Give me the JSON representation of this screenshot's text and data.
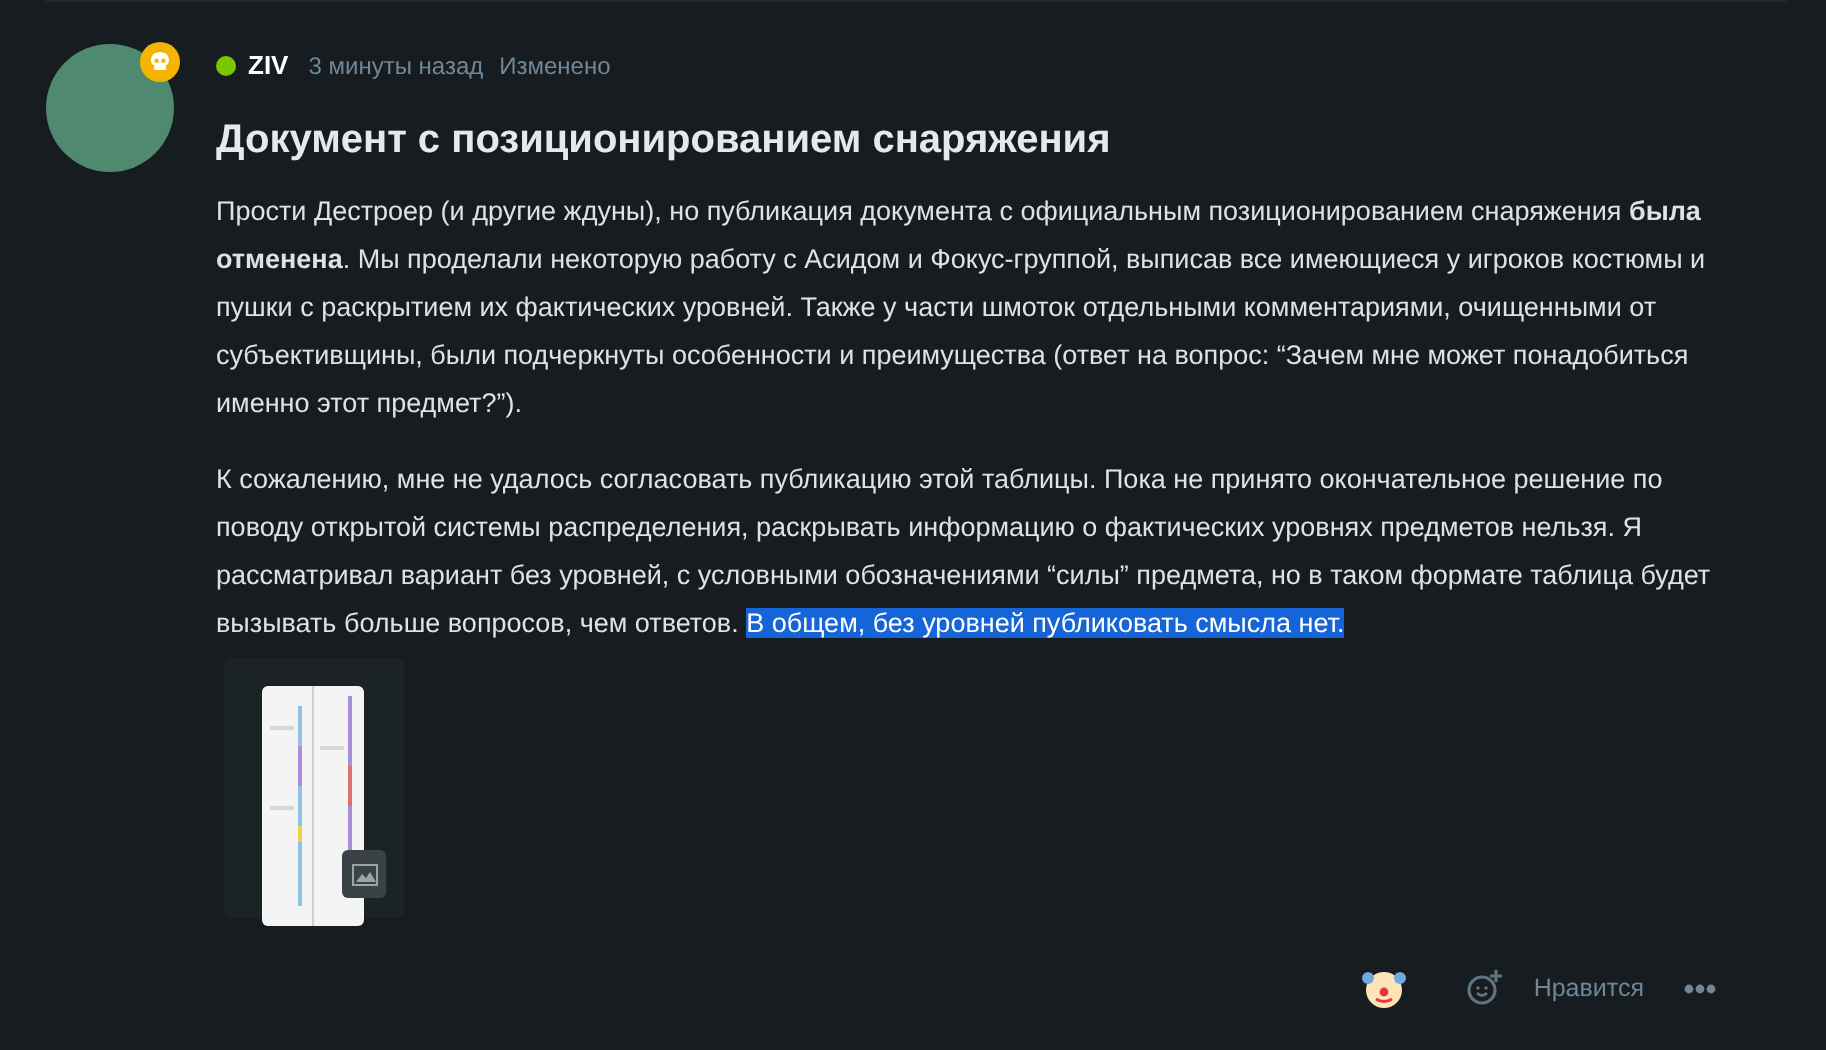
{
  "post": {
    "author": "ZIV",
    "online": true,
    "time": "3 минуты назад",
    "edited": "Изменено",
    "title": "Документ с позиционированием снаряжения",
    "paragraphs": [
      {
        "text": "Прости Дестроер (и другие ждуны), но публикация документа с официальным позиционированием снаряжения **была отменена**. Мы проделали некоторую работу с Асидом и Фокус-группой, выписав все имеющиеся у игроков костюмы и пушки с раскрытием их фактических уровней. Также у части шмоток отдельными комментариями, очищенными от субъективщины, были подчеркнуты особенности и преимущества (ответ на вопрос: “Зачем мне может понадобиться именно этот предмет?”)."
      },
      {
        "text": "К сожалению, мне не удалось согласовать публикацию этой таблицы. Пока не принято окончательное решение по поводу открытой системы распределения, раскрывать информацию о фактических уровнях предметов нельзя. Я рассматривал вариант без уровней, с условными обозначениями “силы” предмета, но в таком формате таблица будет вызывать больше вопросов, чем ответов. ",
        "selected_text": "В общем, без уровней публиковать смысла нет."
      }
    ],
    "like_label": "Нравится"
  }
}
